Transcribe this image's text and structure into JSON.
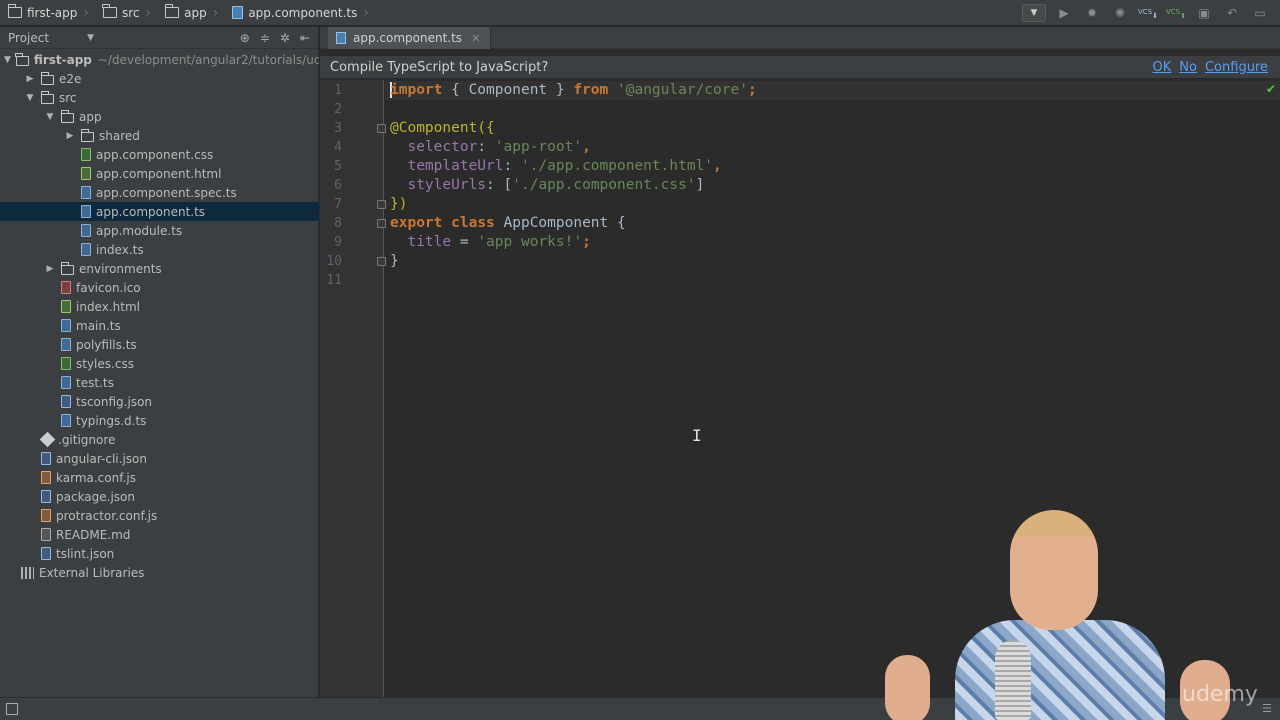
{
  "navbar": {
    "breadcrumbs": [
      {
        "label": "first-app",
        "icon": "folder-icon"
      },
      {
        "label": "src",
        "icon": "folder-icon"
      },
      {
        "label": "app",
        "icon": "folder-icon"
      },
      {
        "label": "app.component.ts",
        "icon": "ts-file-icon"
      }
    ],
    "vcs_label": "VCS"
  },
  "project_panel": {
    "title": "Project",
    "tree": [
      {
        "label": "first-app",
        "path": "~/development/angular2/tutorials/ud",
        "type": "folder",
        "depth": 0,
        "expanded": true
      },
      {
        "label": "e2e",
        "type": "folder",
        "depth": 1,
        "expanded": false
      },
      {
        "label": "src",
        "type": "folder",
        "depth": 1,
        "expanded": true
      },
      {
        "label": "app",
        "type": "folder",
        "depth": 2,
        "expanded": true
      },
      {
        "label": "shared",
        "type": "folder",
        "depth": 3,
        "expanded": false
      },
      {
        "label": "app.component.css",
        "type": "css",
        "depth": 3
      },
      {
        "label": "app.component.html",
        "type": "html",
        "depth": 3
      },
      {
        "label": "app.component.spec.ts",
        "type": "ts",
        "depth": 3
      },
      {
        "label": "app.component.ts",
        "type": "ts",
        "depth": 3,
        "selected": true
      },
      {
        "label": "app.module.ts",
        "type": "ts",
        "depth": 3
      },
      {
        "label": "index.ts",
        "type": "ts",
        "depth": 3
      },
      {
        "label": "environments",
        "type": "folder",
        "depth": 2,
        "expanded": false
      },
      {
        "label": "favicon.ico",
        "type": "ico",
        "depth": 2
      },
      {
        "label": "index.html",
        "type": "html",
        "depth": 2
      },
      {
        "label": "main.ts",
        "type": "ts",
        "depth": 2
      },
      {
        "label": "polyfills.ts",
        "type": "ts",
        "depth": 2
      },
      {
        "label": "styles.css",
        "type": "css",
        "depth": 2
      },
      {
        "label": "test.ts",
        "type": "ts",
        "depth": 2
      },
      {
        "label": "tsconfig.json",
        "type": "json",
        "depth": 2
      },
      {
        "label": "typings.d.ts",
        "type": "ts",
        "depth": 2
      },
      {
        "label": ".gitignore",
        "type": "git",
        "depth": 1
      },
      {
        "label": "angular-cli.json",
        "type": "json",
        "depth": 1
      },
      {
        "label": "karma.conf.js",
        "type": "js",
        "depth": 1
      },
      {
        "label": "package.json",
        "type": "json",
        "depth": 1
      },
      {
        "label": "protractor.conf.js",
        "type": "js",
        "depth": 1
      },
      {
        "label": "README.md",
        "type": "md",
        "depth": 1
      },
      {
        "label": "tslint.json",
        "type": "json",
        "depth": 1
      },
      {
        "label": "External Libraries",
        "type": "lib",
        "depth": 0
      }
    ]
  },
  "editor": {
    "tab_label": "app.component.ts",
    "banner": {
      "text": "Compile TypeScript to JavaScript?",
      "ok": "OK",
      "no": "No",
      "configure": "Configure"
    },
    "line_numbers": [
      "1",
      "2",
      "3",
      "4",
      "5",
      "6",
      "7",
      "8",
      "9",
      "10",
      "11"
    ],
    "code": {
      "l1_kw": "import",
      "l1_mid": " { Component } ",
      "l1_from": "from",
      "l1_str": "'@angular/core'",
      "l1_end": ";",
      "l3": "@Component({",
      "l4_prop": "selector",
      "l4_str": "'app-root'",
      "l5_prop": "templateUrl",
      "l5_str": "'./app.component.html'",
      "l6_prop": "styleUrls",
      "l6_str": "'./app.component.css'",
      "l7": "})",
      "l8_kw1": "export",
      "l8_kw2": "class",
      "l8_name": " AppComponent {",
      "l9_prop": "title",
      "l9_str": "'app works!'",
      "l10": "}"
    }
  },
  "webcam": {
    "watermark": "udemy"
  },
  "colors": {
    "keyword": "#cc7832",
    "string": "#6a8759",
    "property": "#9876aa",
    "link": "#589df6",
    "selection": "#0d293e"
  }
}
